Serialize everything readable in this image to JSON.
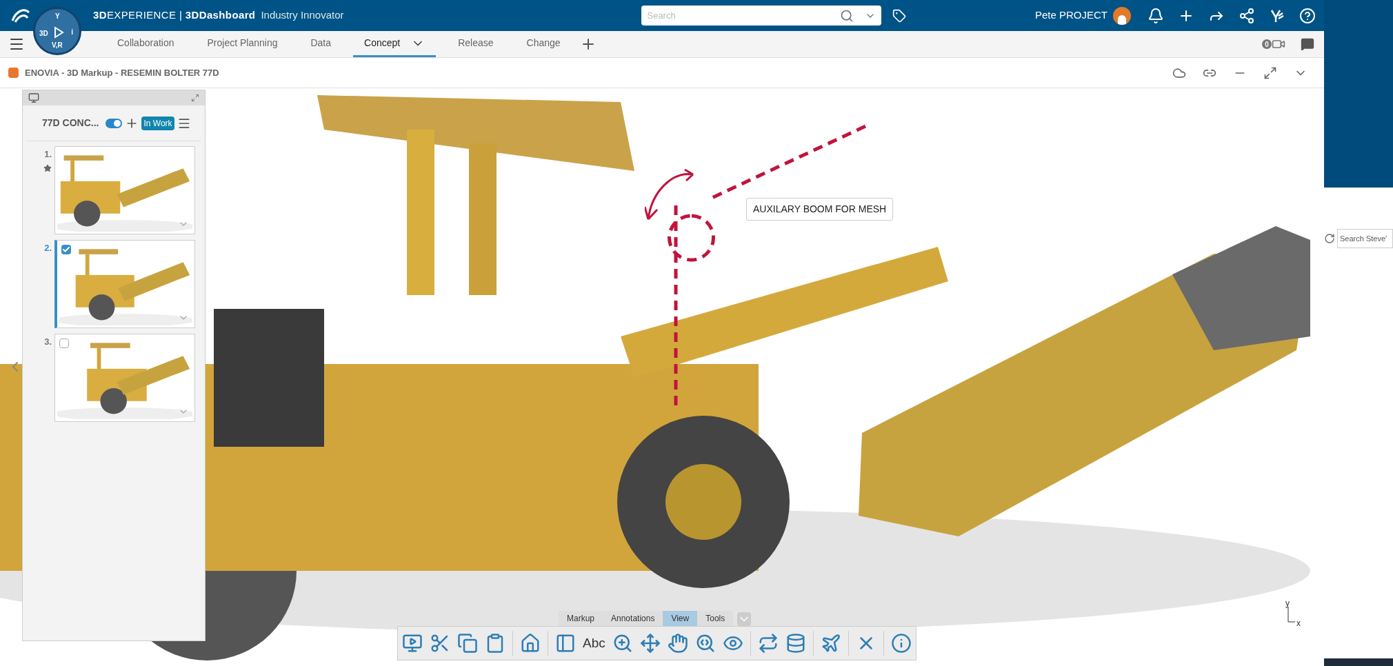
{
  "header": {
    "brand": "**3D**EXPERIENCE | **3DDashboard**",
    "app": "Industry Innovator",
    "search": {
      "placeholder": "Search"
    },
    "user": "Pete PROJECT"
  },
  "compass": {
    "top": "Y",
    "left": "3D",
    "right": "i",
    "bottom": "V,R"
  },
  "tabs": [
    {
      "label": "Collaboration",
      "selected": false
    },
    {
      "label": "Project Planning",
      "selected": false
    },
    {
      "label": "Data",
      "selected": false
    },
    {
      "label": "Concept",
      "selected": true
    },
    {
      "label": "Release",
      "selected": false
    },
    {
      "label": "Change",
      "selected": false
    }
  ],
  "video_badge": "0",
  "widget": {
    "title": "ENOVIA - 3D Markup - RESEMIN BOLTER 77D"
  },
  "panel": {
    "title": "77D CONC...",
    "toggle_on": true,
    "status": "In Work",
    "slides": [
      {
        "number": "1.",
        "starred": true,
        "selected": false
      },
      {
        "number": "2.",
        "starred": false,
        "selected": true,
        "checked": true
      },
      {
        "number": "3.",
        "starred": false,
        "selected": false,
        "checked": false
      }
    ]
  },
  "annotation": "AUXILARY BOOM FOR MESH",
  "axis": {
    "y": "y",
    "x": "x"
  },
  "toolbar": {
    "tabs": [
      {
        "label": "Markup",
        "selected": false
      },
      {
        "label": "Annotations",
        "selected": false
      },
      {
        "label": "View",
        "selected": true
      },
      {
        "label": "Tools",
        "selected": false
      }
    ],
    "text_tool": "Abc"
  },
  "side": {
    "search": {
      "placeholder": "Search Steve'"
    }
  }
}
